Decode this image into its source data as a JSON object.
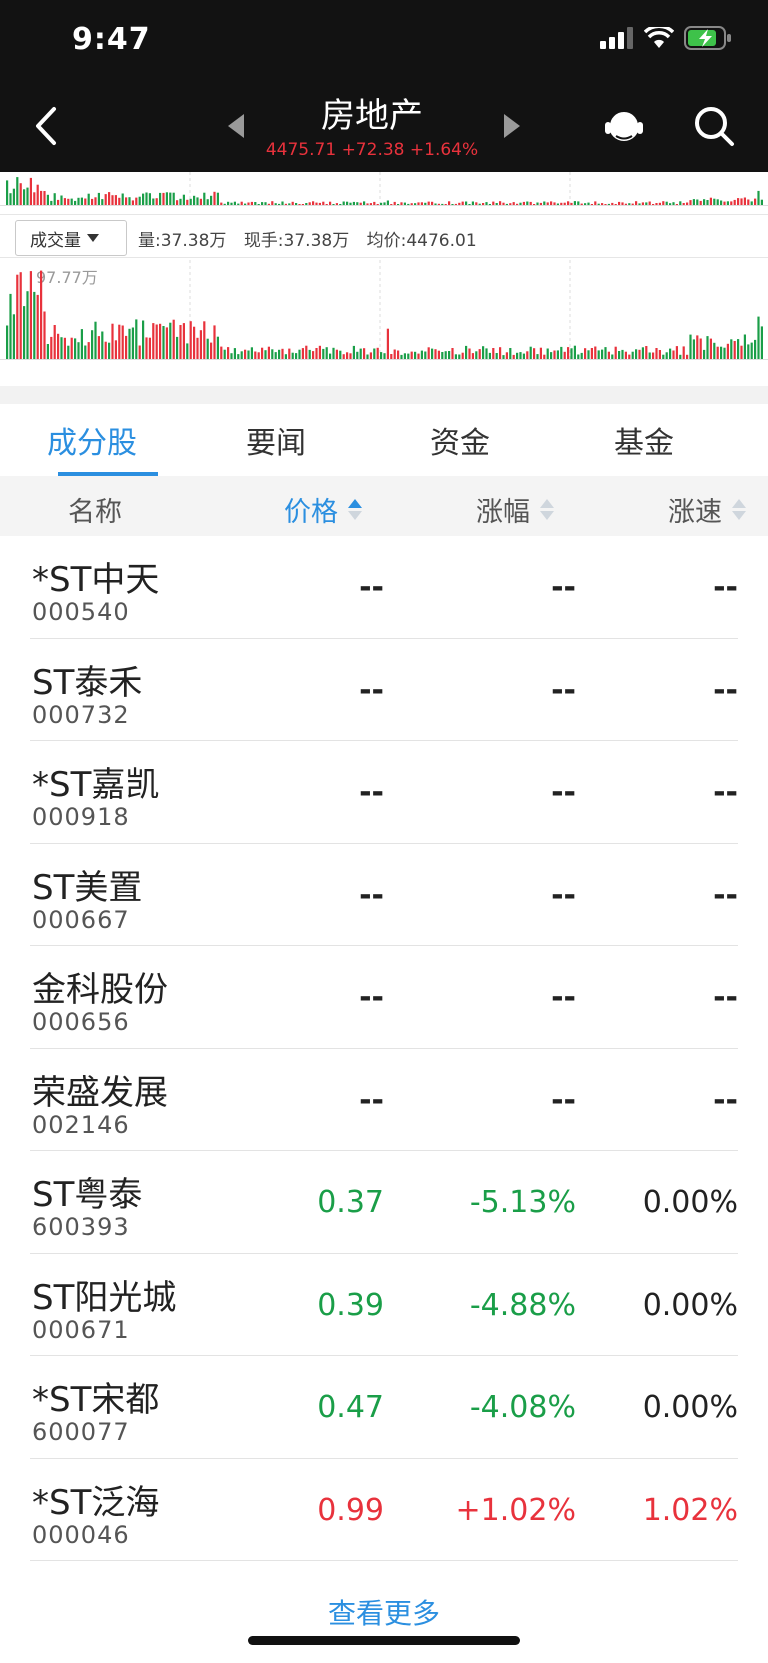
{
  "status": {
    "time": "9:47"
  },
  "nav": {
    "title": "房地产",
    "quote": "4475.71 +72.38 +1.64%"
  },
  "volume": {
    "selector": "成交量",
    "vol": "量:37.38万",
    "current": "现手:37.38万",
    "avg": "均价:4476.01",
    "max": "97.77万"
  },
  "colors": {
    "accent": "#2b8fe0",
    "up": "#e8323c",
    "down": "#1a9e48",
    "dark": "#121212"
  },
  "tabs": [
    {
      "label": "成分股"
    },
    {
      "label": "要闻"
    },
    {
      "label": "资金"
    },
    {
      "label": "基金"
    }
  ],
  "table": {
    "headers": {
      "name": "名称",
      "price": "价格",
      "change": "涨幅",
      "speed": "涨速"
    },
    "rows": [
      {
        "name": "*ST中天",
        "code": "000540",
        "price": "--",
        "change": "--",
        "speed": "--"
      },
      {
        "name": "ST泰禾",
        "code": "000732",
        "price": "--",
        "change": "--",
        "speed": "--"
      },
      {
        "name": "*ST嘉凯",
        "code": "000918",
        "price": "--",
        "change": "--",
        "speed": "--"
      },
      {
        "name": "ST美置",
        "code": "000667",
        "price": "--",
        "change": "--",
        "speed": "--"
      },
      {
        "name": "金科股份",
        "code": "000656",
        "price": "--",
        "change": "--",
        "speed": "--"
      },
      {
        "name": "荣盛发展",
        "code": "002146",
        "price": "--",
        "change": "--",
        "speed": "--"
      },
      {
        "name": "ST粤泰",
        "code": "600393",
        "price": "0.37",
        "change": "-5.13%",
        "speed": "0.00%"
      },
      {
        "name": "ST阳光城",
        "code": "000671",
        "price": "0.39",
        "change": "-4.88%",
        "speed": "0.00%"
      },
      {
        "name": "*ST宋都",
        "code": "600077",
        "price": "0.47",
        "change": "-4.08%",
        "speed": "0.00%"
      },
      {
        "name": "*ST泛海",
        "code": "000046",
        "price": "0.99",
        "change": "+1.02%",
        "speed": "1.02%"
      }
    ]
  },
  "more_label": "查看更多"
}
